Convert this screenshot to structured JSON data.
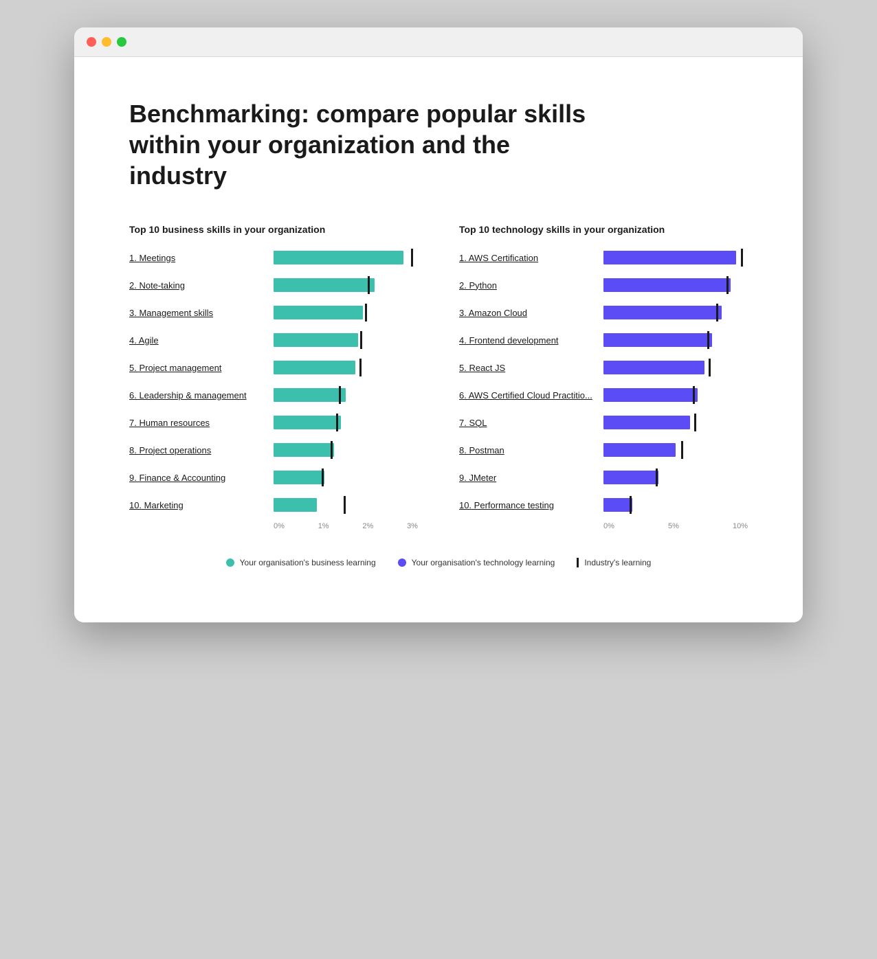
{
  "page": {
    "title": "Benchmarking: compare popular skills within your organization and the industry"
  },
  "browser": {
    "traffic_lights": [
      "red",
      "yellow",
      "green"
    ]
  },
  "business_chart": {
    "section_title": "Top 10 business skills in your organization",
    "max_value": 3,
    "axis_labels": [
      "0%",
      "1%",
      "2%",
      "3%"
    ],
    "bars": [
      {
        "label": "1. Meetings",
        "value": 2.7,
        "industry": 2.85
      },
      {
        "label": "2. Note-taking",
        "value": 2.1,
        "industry": 1.95
      },
      {
        "label": "3. Management skills",
        "value": 1.85,
        "industry": 1.9
      },
      {
        "label": "4. Agile",
        "value": 1.75,
        "industry": 1.8
      },
      {
        "label": "5. Project management",
        "value": 1.7,
        "industry": 1.78
      },
      {
        "label": "6. Leadership & management",
        "value": 1.5,
        "industry": 1.35
      },
      {
        "label": "7. Human resources",
        "value": 1.4,
        "industry": 1.3
      },
      {
        "label": "8. Project operations",
        "value": 1.25,
        "industry": 1.18
      },
      {
        "label": "9. Finance & Accounting",
        "value": 1.05,
        "industry": 1.0
      },
      {
        "label": "10. Marketing",
        "value": 0.9,
        "industry": 1.45
      }
    ]
  },
  "technology_chart": {
    "section_title": "Top 10 technology skills in your organization",
    "max_value": 10,
    "axis_labels": [
      "0%",
      "5%",
      "10%"
    ],
    "bars": [
      {
        "label": "1. AWS Certification",
        "value": 9.2,
        "industry": 9.5
      },
      {
        "label": "2. Python",
        "value": 8.8,
        "industry": 8.5
      },
      {
        "label": "3. Amazon Cloud",
        "value": 8.2,
        "industry": 7.8
      },
      {
        "label": "4. Frontend development",
        "value": 7.5,
        "industry": 7.2
      },
      {
        "label": "5.  React JS",
        "value": 7.0,
        "industry": 7.3
      },
      {
        "label": "6. AWS Certified Cloud Practitio...",
        "value": 6.5,
        "industry": 6.2
      },
      {
        "label": "7. SQL",
        "value": 6.0,
        "industry": 6.3
      },
      {
        "label": "8. Postman",
        "value": 5.0,
        "industry": 5.4
      },
      {
        "label": "9. JMeter",
        "value": 3.8,
        "industry": 3.6
      },
      {
        "label": "10. Performance testing",
        "value": 2.0,
        "industry": 1.8
      }
    ]
  },
  "legend": {
    "business_label": "Your organisation's business learning",
    "technology_label": "Your organisation's technology learning",
    "industry_label": "Industry's learning"
  }
}
